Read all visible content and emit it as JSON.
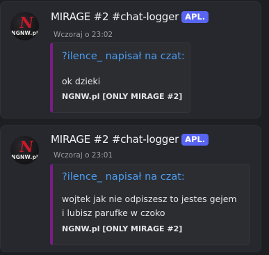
{
  "messages": [
    {
      "author": "MIRAGE #2 #chat-logger",
      "badge": "APL.",
      "timestamp": "Wczoraj o 23:02",
      "avatar": {
        "logo_text": "NGNW.pl",
        "logo_letter": "N",
        "accent": "#c8182a"
      },
      "embed": {
        "author": "?ilence_ napisał na czat:",
        "description": "ok dzieki",
        "footer": "NGNW.pl [ONLY MIRAGE #2]",
        "color": "#7a1d86"
      }
    },
    {
      "author": "MIRAGE #2 #chat-logger",
      "badge": "APL.",
      "timestamp": "Wczoraj o 23:01",
      "avatar": {
        "logo_text": "NGNW.pl",
        "logo_letter": "N",
        "accent": "#c8182a"
      },
      "embed": {
        "author": "?ilence_ napisał na czat:",
        "description": "wojtek jak nie odpiszesz to jestes gejem i lubisz parufke w czoko",
        "footer": "NGNW.pl [ONLY MIRAGE #2]",
        "color": "#7a1d86"
      }
    }
  ]
}
